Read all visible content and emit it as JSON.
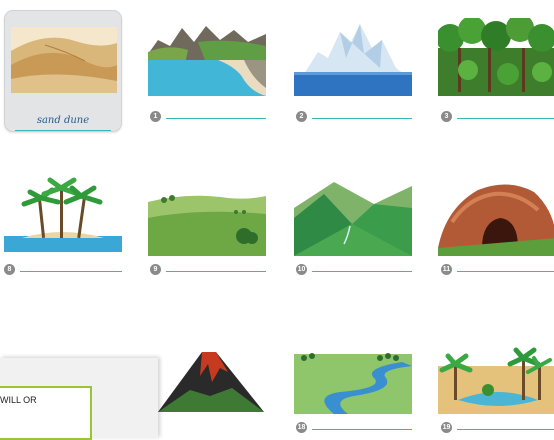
{
  "example": {
    "answer": "sand dune",
    "picture": "sand-dune"
  },
  "items": [
    {
      "number": "1",
      "picture": "coast"
    },
    {
      "number": "2",
      "picture": "iceberg"
    },
    {
      "number": "3",
      "picture": "rainforest"
    },
    {
      "number": "8",
      "picture": "island"
    },
    {
      "number": "9",
      "picture": "grassland"
    },
    {
      "number": "10",
      "picture": "valley"
    },
    {
      "number": "11",
      "picture": "cave"
    },
    {
      "number": "",
      "picture": "volcano"
    },
    {
      "number": "18",
      "picture": "river"
    },
    {
      "number": "19",
      "picture": "oasis"
    }
  ],
  "note": {
    "text": "WILL OR"
  },
  "colors": {
    "answer_line": "#3ab7b3",
    "note_border": "#9bc43a",
    "number_circle": "#8a8a8a"
  }
}
